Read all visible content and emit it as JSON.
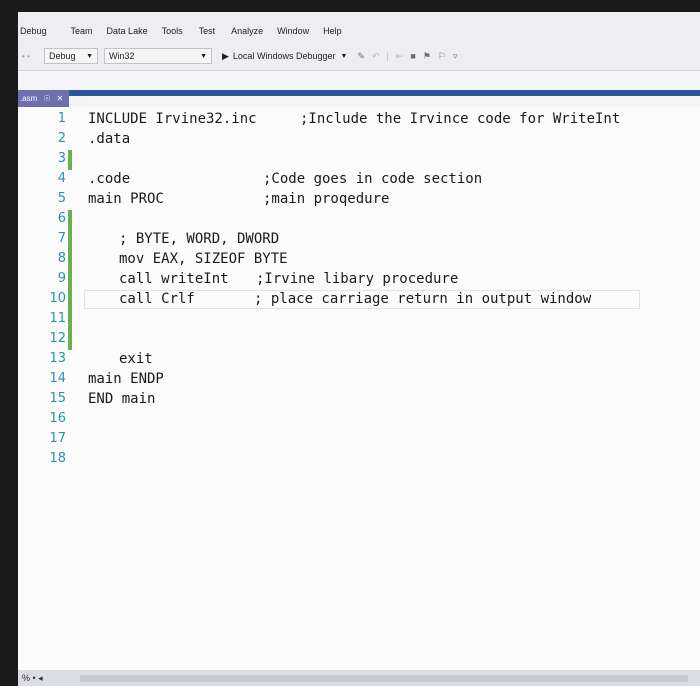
{
  "menu": [
    "Debug",
    "Team",
    "Data Lake",
    "Tools",
    "Test",
    "Analyze",
    "Window",
    "Help"
  ],
  "toolbar": {
    "configuration": "Debug",
    "platform": "Win32",
    "run_target": "Local Windows Debugger",
    "icons": [
      "pin-icon",
      "undo-icon",
      "bookmark-icon",
      "bookmark-prev-icon",
      "bookmark-next-icon",
      "overflow-icon"
    ]
  },
  "tab": {
    "name": ".asm",
    "pin": "☉",
    "close": "✕"
  },
  "editor": {
    "lines": [
      {
        "num": "1",
        "code": "INCLUDE Irvine32.inc",
        "comment": ";Include the Irvince code for WriteInt",
        "indent": "l1"
      },
      {
        "num": "2",
        "code": ".data",
        "comment": "",
        "indent": "l1"
      },
      {
        "num": "3",
        "code": "",
        "comment": "",
        "indent": "l1",
        "bar": true
      },
      {
        "num": "4",
        "code": ".code",
        "comment": ";Code goes in code section",
        "indent": "l1"
      },
      {
        "num": "5",
        "code": "main PROC",
        "comment": ";main proqedure",
        "indent": "l1"
      },
      {
        "num": "6",
        "code": "",
        "comment": "",
        "indent": "l1",
        "bar": true
      },
      {
        "num": "7",
        "code": "; BYTE, WORD, DWORD",
        "comment": "",
        "indent": "l2",
        "bar": true
      },
      {
        "num": "8",
        "code": "mov EAX, SIZEOF BYTE",
        "comment": "",
        "indent": "l2",
        "bar": true
      },
      {
        "num": "9",
        "code": "call writeInt",
        "comment": ";Irvine libary procedure",
        "indent": "l2",
        "bar": true
      },
      {
        "num": "10",
        "code": "call Crlf",
        "comment": "; place carriage return in output window",
        "indent": "l2",
        "bar": true,
        "current": true
      },
      {
        "num": "11",
        "code": "",
        "comment": "",
        "indent": "l1",
        "bar": true
      },
      {
        "num": "12",
        "code": "",
        "comment": "",
        "indent": "l1",
        "bar": true
      },
      {
        "num": "13",
        "code": "exit",
        "comment": "",
        "indent": "l2"
      },
      {
        "num": "14",
        "code": "main ENDP",
        "comment": "",
        "indent": "l1"
      },
      {
        "num": "15",
        "code": "END main",
        "comment": "",
        "indent": "l1"
      },
      {
        "num": "16",
        "code": "",
        "comment": "",
        "indent": "l1"
      },
      {
        "num": "17",
        "code": "",
        "comment": "",
        "indent": "l1"
      },
      {
        "num": "18",
        "code": "",
        "comment": "",
        "indent": "l1"
      }
    ]
  },
  "status": {
    "left": "% • ◂"
  },
  "colors": {
    "line_number": "#2b91af",
    "change_bar": "#6ab04c",
    "tab_accent": "#2b579a"
  }
}
